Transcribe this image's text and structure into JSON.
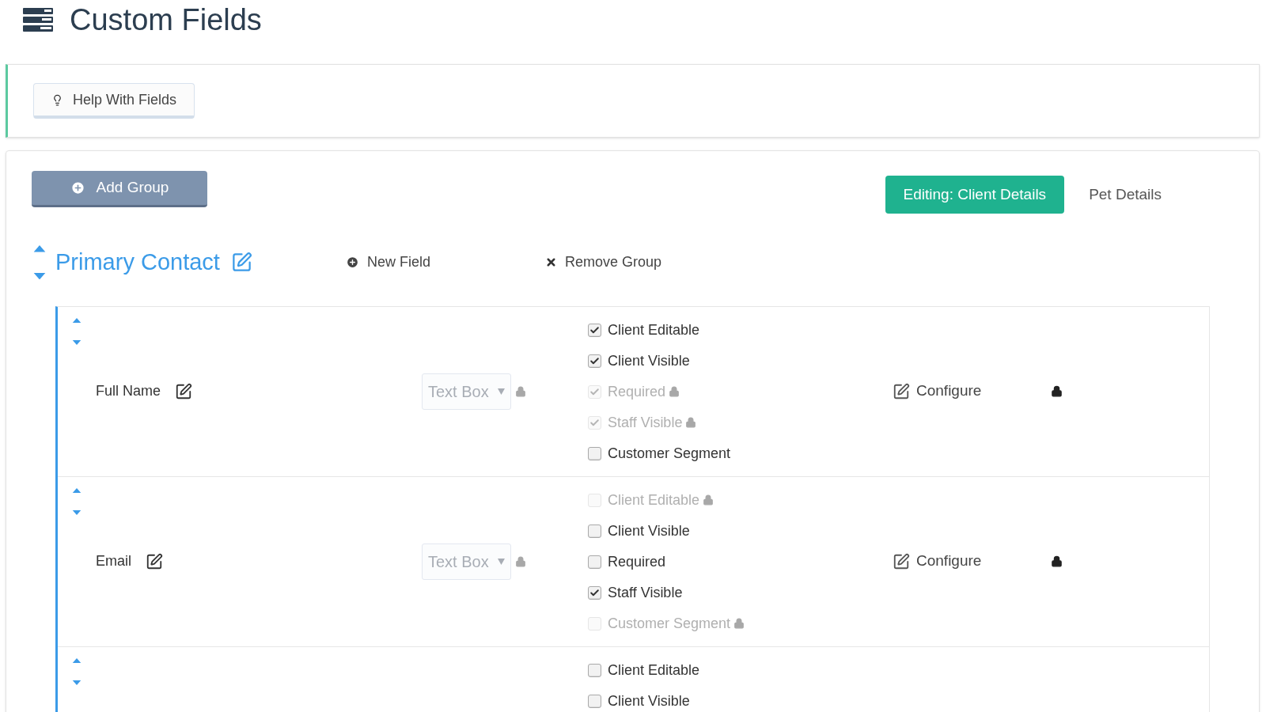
{
  "page": {
    "title": "Custom Fields"
  },
  "help_button": {
    "label": "Help With Fields"
  },
  "add_group_button": {
    "label": "Add Group"
  },
  "tabs": [
    {
      "label": "Editing: Client Details",
      "selected": true
    },
    {
      "label": "Pet Details",
      "selected": false
    }
  ],
  "group": {
    "title": "Primary Contact",
    "actions": [
      {
        "kind": "add",
        "label": "New Field"
      },
      {
        "kind": "remove",
        "label": "Remove Group"
      }
    ],
    "fields": [
      {
        "name": "Full Name",
        "type": {
          "value": "Text Box",
          "locked": true
        },
        "options": [
          {
            "label": "Client Editable",
            "checked": true,
            "disabled": false
          },
          {
            "label": "Client Visible",
            "checked": true,
            "disabled": false
          },
          {
            "label": "Required",
            "checked": true,
            "disabled": true
          },
          {
            "label": "Staff Visible",
            "checked": true,
            "disabled": true
          },
          {
            "label": "Customer Segment",
            "checked": false,
            "disabled": false
          }
        ],
        "configure": "Configure",
        "locked": true
      },
      {
        "name": "Email",
        "type": {
          "value": "Text Box",
          "locked": true
        },
        "options": [
          {
            "label": "Client Editable",
            "checked": false,
            "disabled": true
          },
          {
            "label": "Client Visible",
            "checked": false,
            "disabled": false
          },
          {
            "label": "Required",
            "checked": false,
            "disabled": false
          },
          {
            "label": "Staff Visible",
            "checked": true,
            "disabled": false
          },
          {
            "label": "Customer Segment",
            "checked": false,
            "disabled": true
          }
        ],
        "configure": "Configure",
        "locked": true
      },
      {
        "options": [
          {
            "label": "Client Editable",
            "checked": false,
            "disabled": false
          },
          {
            "label": "Client Visible",
            "checked": false,
            "disabled": false
          }
        ]
      }
    ]
  }
}
